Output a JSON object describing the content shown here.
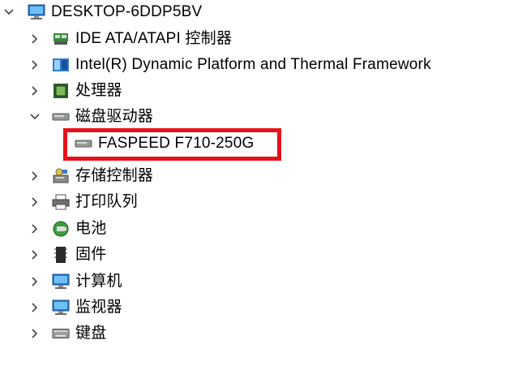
{
  "tree": {
    "root": {
      "label": "DESKTOP-6DDP5BV",
      "expanded": true,
      "icon": "computer-icon"
    },
    "items": [
      {
        "label": "IDE ATA/ATAPI 控制器",
        "icon": "ide-controller-icon",
        "expanded": false
      },
      {
        "label": "Intel(R) Dynamic Platform and Thermal Framework",
        "icon": "thermal-framework-icon",
        "expanded": false
      },
      {
        "label": "处理器",
        "icon": "processor-icon",
        "expanded": false
      },
      {
        "label": "磁盘驱动器",
        "icon": "disk-drive-icon",
        "expanded": true
      },
      {
        "label": "FASPEED F710-250G",
        "icon": "disk-icon",
        "child": true
      },
      {
        "label": "存储控制器",
        "icon": "storage-controller-icon",
        "expanded": false
      },
      {
        "label": "打印队列",
        "icon": "printer-icon",
        "expanded": false
      },
      {
        "label": "电池",
        "icon": "battery-icon",
        "expanded": false
      },
      {
        "label": "固件",
        "icon": "firmware-icon",
        "expanded": false
      },
      {
        "label": "计算机",
        "icon": "monitor-icon",
        "expanded": false
      },
      {
        "label": "监视器",
        "icon": "monitor-icon",
        "expanded": false
      },
      {
        "label": "键盘",
        "icon": "keyboard-icon",
        "expanded": false
      }
    ]
  },
  "highlight_color": "#e8101a"
}
